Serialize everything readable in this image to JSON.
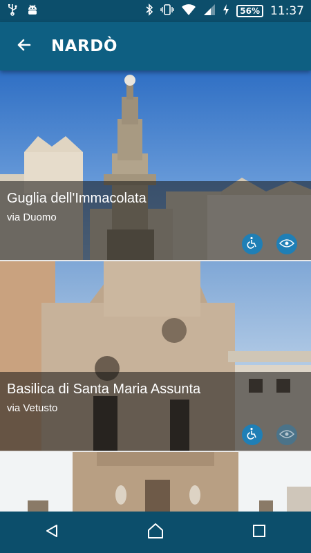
{
  "status": {
    "battery": "56%",
    "time": "11:37",
    "icons": [
      "usb-icon",
      "android-debug-icon",
      "bluetooth-icon",
      "vibrate-icon",
      "wifi-icon",
      "signal-icon",
      "charging-icon"
    ]
  },
  "appbar": {
    "title": "NARDÒ",
    "back_icon": "arrow-back-icon"
  },
  "places": [
    {
      "title": "Guglia dell'Immacolata",
      "address": "via Duomo",
      "accessible": true,
      "viewable": true
    },
    {
      "title": "Basilica di Santa Maria Assunta",
      "address": "via Vetusto",
      "accessible": true,
      "viewable": false
    },
    {
      "title": "",
      "address": "",
      "accessible": false,
      "viewable": false
    }
  ],
  "colors": {
    "status_bar": "#0c4e6b",
    "app_bar": "#0e5f82",
    "icon_accent": "#1f7fb6"
  },
  "navbar": {
    "icons": [
      "back-triangle-icon",
      "home-icon",
      "recents-square-icon"
    ]
  }
}
